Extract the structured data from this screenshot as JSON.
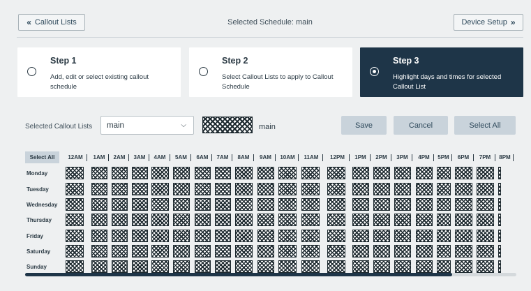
{
  "header": {
    "back_label": "Callout Lists",
    "title": "Selected Schedule: main",
    "device_label": "Device Setup"
  },
  "steps": [
    {
      "title": "Step 1",
      "desc": "Add, edit or select existing callout schedule",
      "active": false
    },
    {
      "title": "Step 2",
      "desc": "Select Callout Lists to apply to Callout Schedule",
      "active": false
    },
    {
      "title": "Step 3",
      "desc": "Highlight days and times for selected Callout List",
      "active": true
    }
  ],
  "callout": {
    "label": "Selected Callout Lists",
    "selected": "main",
    "swatch_label": "main"
  },
  "actions": {
    "save": "Save",
    "cancel": "Cancel",
    "select_all": "Select All"
  },
  "grid": {
    "select_all": "Select All",
    "hours": [
      "12AM",
      "1AM",
      "2AM",
      "3AM",
      "4AM",
      "5AM",
      "6AM",
      "7AM",
      "8AM",
      "9AM",
      "10AM",
      "11AM",
      "12PM",
      "1PM",
      "2PM",
      "3PM",
      "4PM",
      "5PM",
      "6PM",
      "7PM",
      "8PM"
    ],
    "days": [
      "Monday",
      "Tuesday",
      "Wednesday",
      "Thursday",
      "Friday",
      "Saturday",
      "Sunday"
    ]
  },
  "colors": {
    "active_step": "#1e3548",
    "button_fill": "#c9d3db",
    "background": "#eef0f1"
  }
}
